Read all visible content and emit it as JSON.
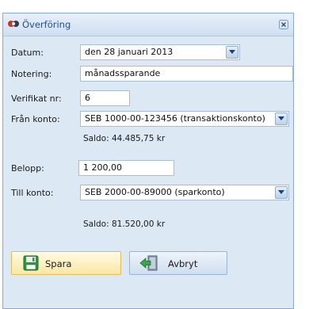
{
  "window": {
    "title": "Överföring",
    "icon": "app-logo-icon",
    "close_icon": "close-icon"
  },
  "form": {
    "datum_label": "Datum:",
    "datum_value": "den 28 januari 2013",
    "notering_label": "Notering:",
    "notering_value": "månadssparande",
    "verifikat_label": "Verifikat nr:",
    "verifikat_value": "6",
    "fran_label": "Från konto:",
    "fran_value": "SEB 1000-00-123456 (transaktionskonto)",
    "fran_saldo": "Saldo: 44.485,75 kr",
    "belopp_label": "Belopp:",
    "belopp_value": "1 200,00",
    "till_label": "Till konto:",
    "till_value": "SEB 2000-00-89000 (sparkonto)",
    "till_saldo": "Saldo: 81.520,00 kr"
  },
  "buttons": {
    "save_label": "Spara",
    "save_icon": "floppy-disk-icon",
    "cancel_label": "Avbryt",
    "cancel_icon": "exit-arrow-icon"
  },
  "colors": {
    "window_bg": "#dde8f5",
    "title_text": "#1e4f98",
    "save_bg": "#fbe6a4",
    "cancel_bg": "#cfdef0"
  }
}
